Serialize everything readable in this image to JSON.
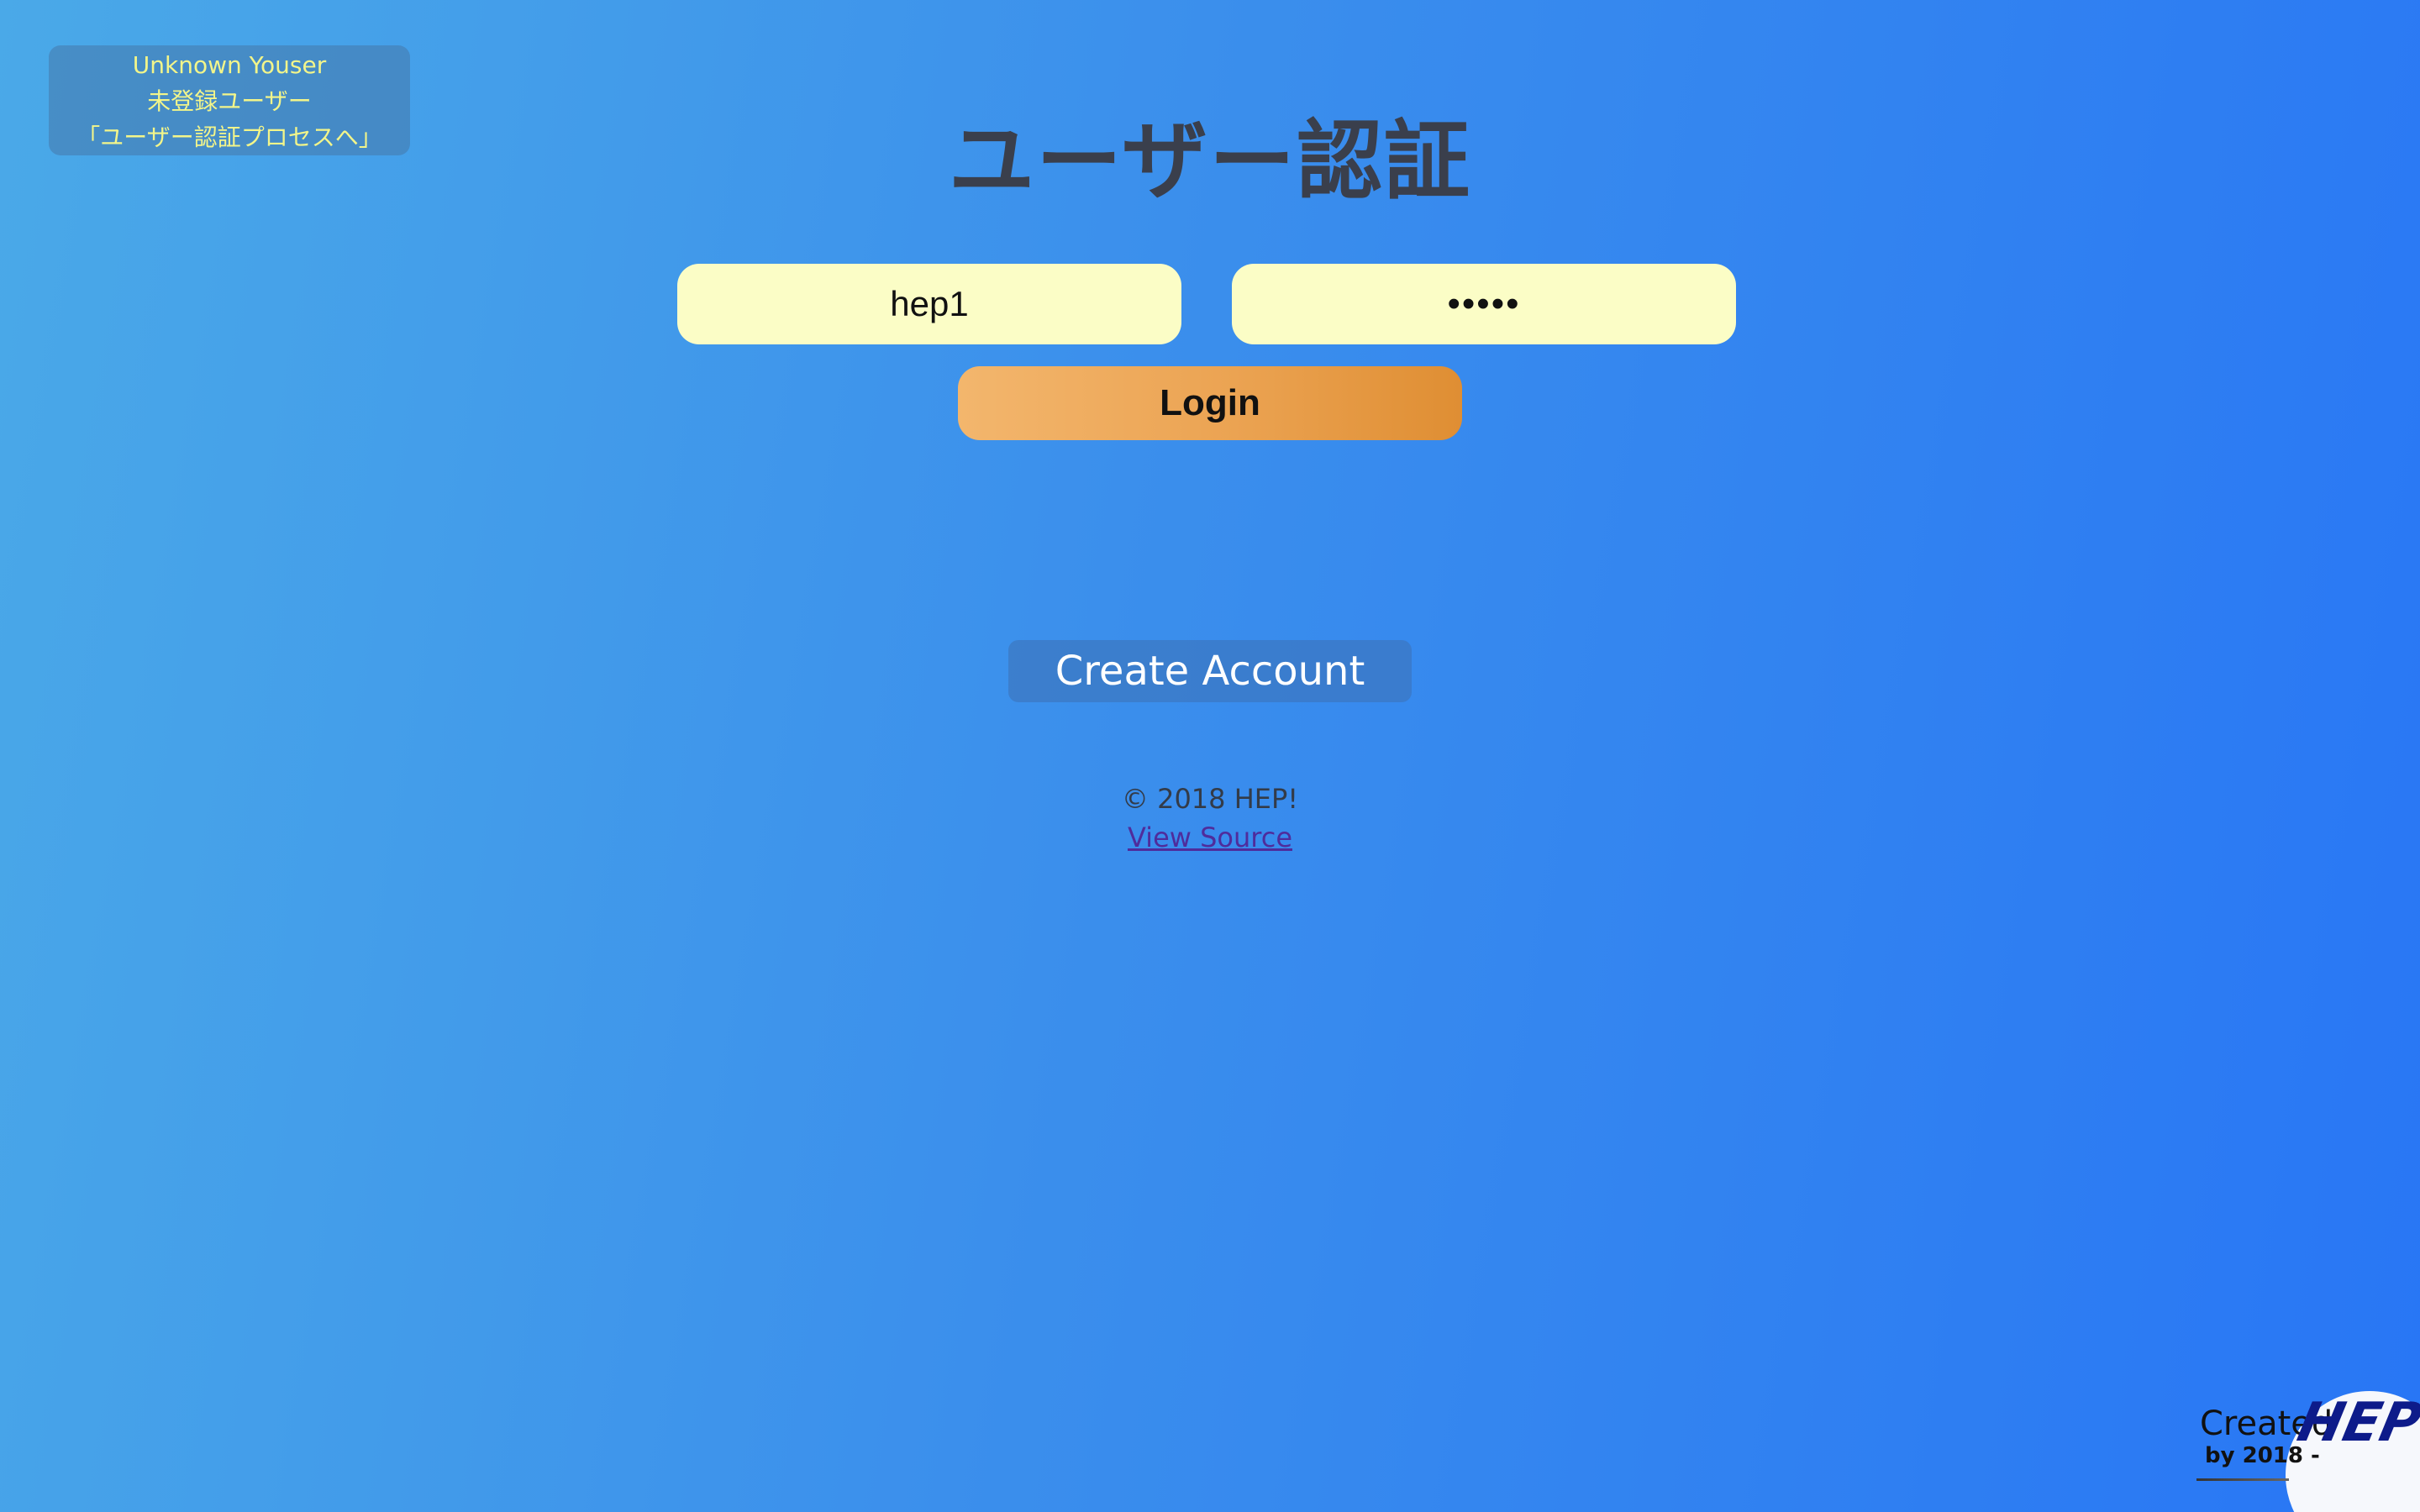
{
  "user_badge": {
    "line1": "Unknown Youser",
    "line2": "未登録ユーザー",
    "line3": "「ユーザー認証プロセスへ」"
  },
  "page": {
    "title": "ユーザー認証"
  },
  "form": {
    "username_value": "hep1",
    "password_value": "•••••",
    "login_label": "Login"
  },
  "create_account": {
    "label": "Create Account"
  },
  "footer": {
    "copyright": "© 2018 HEP!",
    "view_source": "View Source"
  },
  "logo": {
    "created": "Created",
    "by": "by  2018 -",
    "mark": "HEP!"
  },
  "colors": {
    "background_start": "#4aa9e8",
    "background_end": "#2876f5",
    "input_bg": "#fbfdc6",
    "login_button": "#eba352",
    "badge_text": "#f2f58a",
    "title_text": "#3a3f4c",
    "link": "#4f2c9c"
  }
}
